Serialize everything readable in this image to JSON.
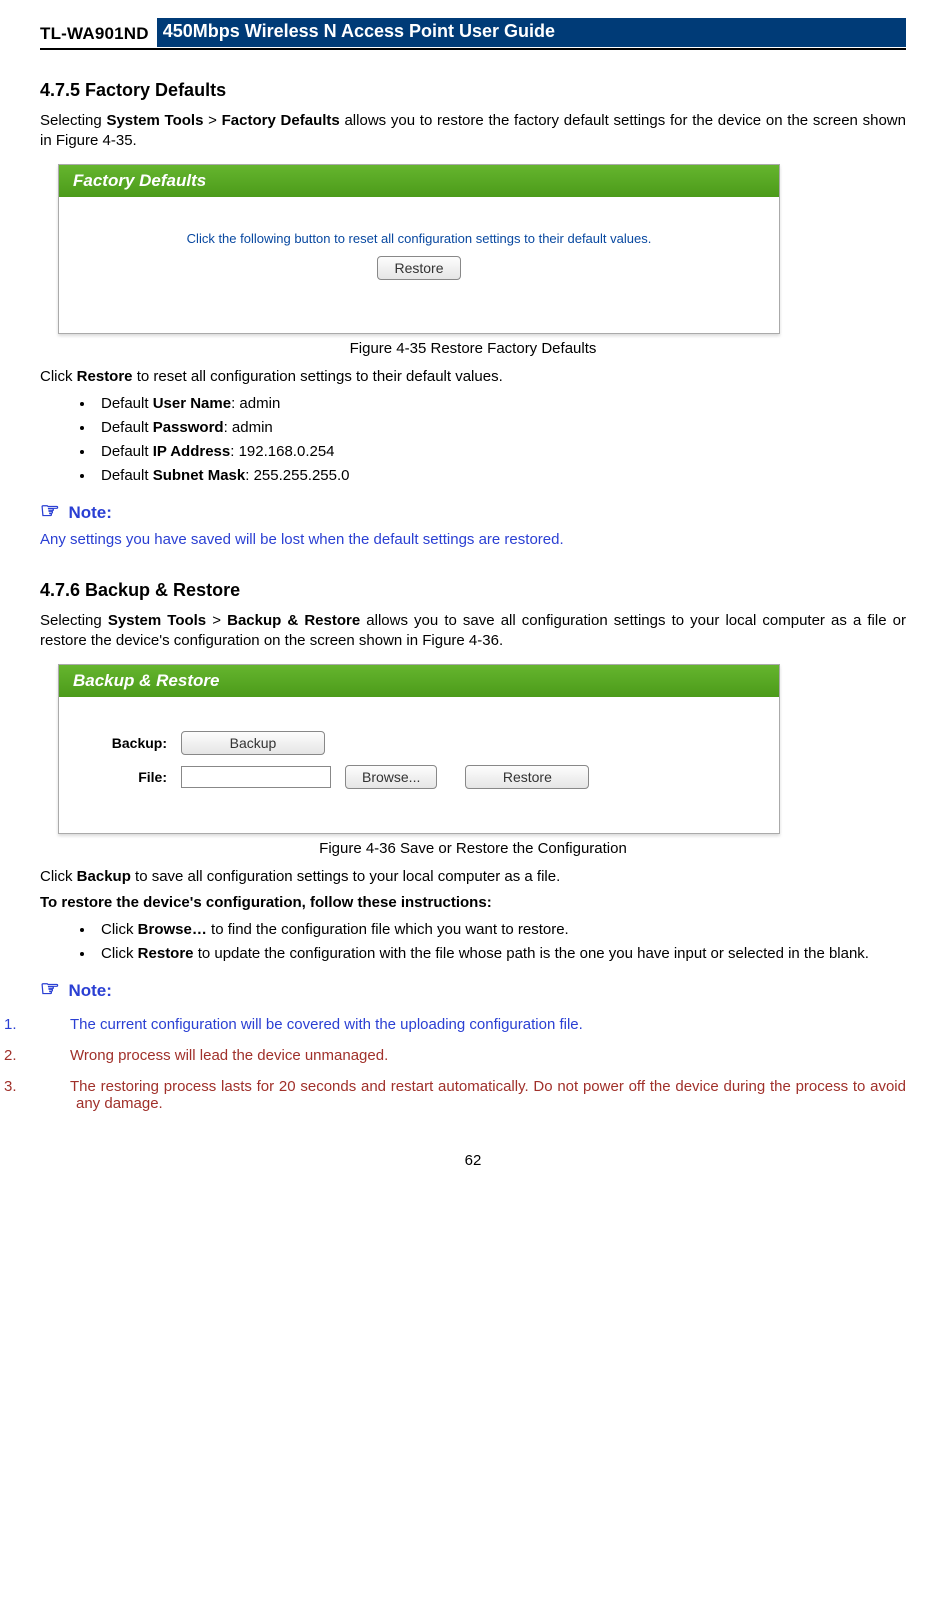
{
  "header": {
    "model": "TL-WA901ND",
    "guide_title": "450Mbps Wireless N Access Point User Guide"
  },
  "sec475": {
    "heading": "4.7.5   Factory Defaults",
    "intro_pre": "Selecting ",
    "intro_b1": "System Tools",
    "intro_sep": " > ",
    "intro_b2": "Factory Defaults",
    "intro_post": " allows you to restore the factory default settings for the device on the screen shown in Figure 4-35.",
    "fig": {
      "bar": "Factory Defaults",
      "text": "Click the following button to reset all configuration settings to their default values.",
      "button": "Restore",
      "caption": "Figure 4-35 Restore Factory Defaults"
    },
    "click_line_pre": "Click ",
    "click_line_b": "Restore",
    "click_line_post": " to reset all configuration settings to their default values.",
    "defaults": {
      "user_k": "User Name",
      "user_v": ": admin",
      "pass_k": "Password",
      "pass_v": ": admin",
      "ip_k": "IP Address",
      "ip_v": ": 192.168.0.254",
      "mask_k": "Subnet Mask",
      "mask_v": ": 255.255.255.0",
      "prefix": "Default "
    },
    "note_label": "Note:",
    "note_text": "Any settings you have saved will be lost when the default settings are restored."
  },
  "sec476": {
    "heading": "4.7.6   Backup & Restore",
    "intro_pre": "Selecting ",
    "intro_b1": "System Tools",
    "intro_sep": " > ",
    "intro_b2": "Backup & Restore",
    "intro_post": " allows you to save all configuration settings to your local computer as a file or restore the device's configuration on the screen shown in Figure 4-36.",
    "fig": {
      "bar": "Backup & Restore",
      "backup_label": "Backup:",
      "backup_button": "Backup",
      "file_label": "File:",
      "browse_button": "Browse...",
      "restore_button": "Restore",
      "caption": "Figure 4-36 Save or Restore the Configuration"
    },
    "click_backup_pre": "Click ",
    "click_backup_b": "Backup",
    "click_backup_post": " to save all configuration settings to your local computer as a file.",
    "restore_heading": "To restore the device's configuration, follow these instructions:",
    "bullets": {
      "b1_pre": "Click ",
      "b1_b": "Browse…",
      "b1_post": " to find the configuration file which you want to restore.",
      "b2_pre": "Click ",
      "b2_b": "Restore",
      "b2_post": " to update the configuration with the file whose path is the one you have input or selected in the blank."
    },
    "note_label": "Note:",
    "notes": {
      "n1_num": "1.",
      "n1_text": "The current configuration will be covered with the uploading configuration file.",
      "n2_num": "2.",
      "n2_text": "Wrong process will lead the device unmanaged.",
      "n3_num": "3.",
      "n3_text": "The restoring process lasts for 20 seconds and restart automatically. Do not power off the device during the process to avoid any damage."
    }
  },
  "page_number": "62"
}
